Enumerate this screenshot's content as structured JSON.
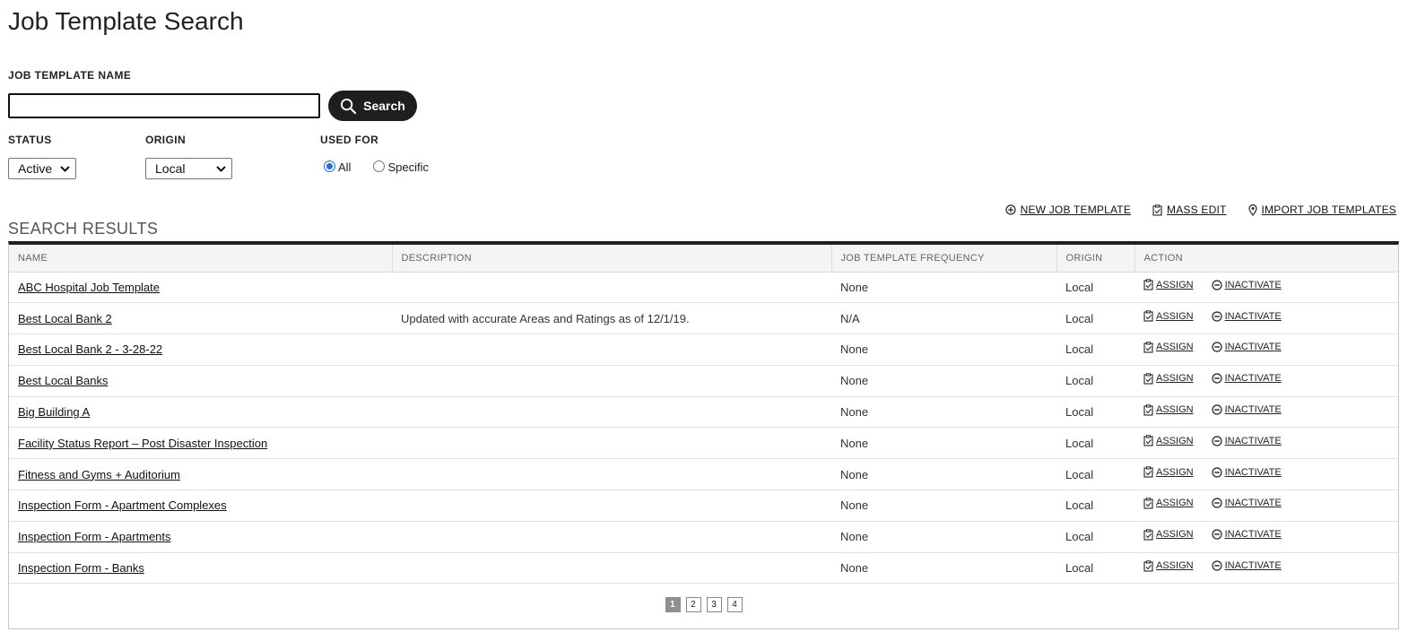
{
  "page": {
    "title": "Job Template Search"
  },
  "search": {
    "name_label": "JOB TEMPLATE NAME",
    "name_value": "",
    "button_label": "Search"
  },
  "filters": {
    "status_label": "STATUS",
    "status_value": "Active",
    "origin_label": "ORIGIN",
    "origin_value": "Local",
    "used_for_label": "USED FOR",
    "used_for_options": [
      {
        "label": "All",
        "checked": true
      },
      {
        "label": "Specific",
        "checked": false
      }
    ]
  },
  "top_actions": {
    "new_job_template": "NEW JOB TEMPLATE",
    "mass_edit": "MASS EDIT",
    "import_job_templates": "IMPORT JOB TEMPLATES"
  },
  "results": {
    "title": "SEARCH RESULTS",
    "columns": [
      "NAME",
      "DESCRIPTION",
      "JOB TEMPLATE FREQUENCY",
      "ORIGIN",
      "ACTION"
    ],
    "assign_label": "ASSIGN",
    "inactivate_label": "INACTIVATE",
    "rows": [
      {
        "name": "ABC Hospital Job Template",
        "description": "",
        "frequency": "None",
        "origin": "Local"
      },
      {
        "name": "Best Local Bank 2",
        "description": "Updated with accurate Areas and Ratings as of 12/1/19.",
        "frequency": "N/A",
        "origin": "Local"
      },
      {
        "name": "Best Local Bank 2 - 3-28-22",
        "description": "",
        "frequency": "None",
        "origin": "Local"
      },
      {
        "name": "Best Local Banks",
        "description": "",
        "frequency": "None",
        "origin": "Local"
      },
      {
        "name": "Big Building A",
        "description": "",
        "frequency": "None",
        "origin": "Local"
      },
      {
        "name": "Facility Status Report – Post Disaster Inspection",
        "description": "",
        "frequency": "None",
        "origin": "Local"
      },
      {
        "name": "Fitness and Gyms + Auditorium",
        "description": "",
        "frequency": "None",
        "origin": "Local"
      },
      {
        "name": "Inspection Form - Apartment Complexes",
        "description": "",
        "frequency": "None",
        "origin": "Local"
      },
      {
        "name": "Inspection Form - Apartments",
        "description": "",
        "frequency": "None",
        "origin": "Local"
      },
      {
        "name": "Inspection Form - Banks",
        "description": "",
        "frequency": "None",
        "origin": "Local"
      }
    ]
  },
  "pagination": {
    "pages": [
      "1",
      "2",
      "3",
      "4"
    ],
    "current": "1"
  }
}
